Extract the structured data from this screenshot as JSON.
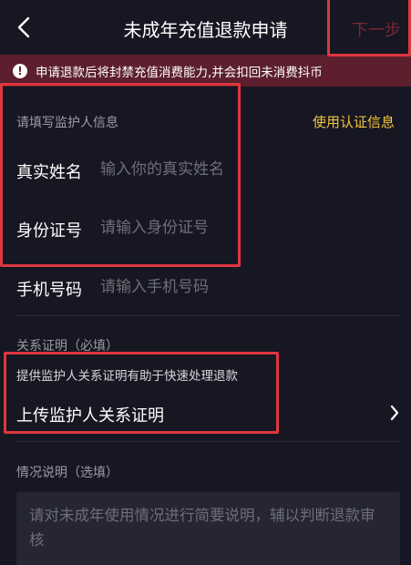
{
  "header": {
    "title": "未成年充值退款申请",
    "next_label": "下一步"
  },
  "banner": {
    "text": "申请退款后将封禁充值消费能力,并会扣回未消费抖币"
  },
  "guardian": {
    "section_title": "请填写监护人信息",
    "use_cert_link": "使用认证信息",
    "name_label": "真实姓名",
    "name_placeholder": "输入你的真实姓名",
    "id_label": "身份证号",
    "id_placeholder": "请输入身份证号",
    "phone_label": "手机号码",
    "phone_placeholder": "请输入手机号码"
  },
  "relation": {
    "section_title": "关系证明（必填）",
    "hint": "提供监护人关系证明有助于快速处理退款",
    "upload_label": "上传监护人关系证明"
  },
  "situation": {
    "section_title": "情况说明（选填）",
    "placeholder": "请对未成年使用情况进行简要说明，辅以判断退款审核"
  },
  "colors": {
    "background": "#161722",
    "banner": "#5d1f2d",
    "accent_link": "#f2c63c",
    "highlight_box": "#e0363f",
    "next_disabled": "#7a2634"
  }
}
